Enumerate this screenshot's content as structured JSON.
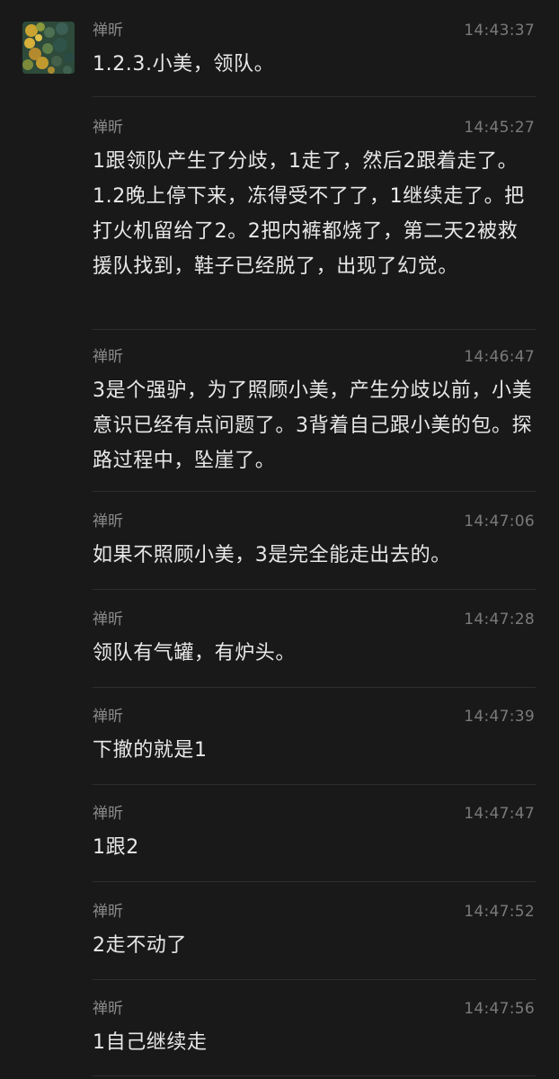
{
  "sender": "禅昕",
  "colors": {
    "background": "#191919",
    "text": "#e8e8e8",
    "meta": "#8b8b8b",
    "divider": "#2e2e2e"
  },
  "messages": [
    {
      "sender": "禅昕",
      "time": "14:43:37",
      "text": "1.2.3.小美，领队。"
    },
    {
      "sender": "禅昕",
      "time": "14:45:27",
      "text": "1跟领队产生了分歧，1走了，然后2跟着走了。1.2晚上停下来，冻得受不了了，1继续走了。把打火机留给了2。2把内裤都烧了，第二天2被救援队找到，鞋子已经脱了，出现了幻觉。"
    },
    {
      "sender": "禅昕",
      "time": "14:46:47",
      "text": "3是个强驴，为了照顾小美，产生分歧以前，小美意识已经有点问题了。3背着自己跟小美的包。探路过程中，坠崖了。"
    },
    {
      "sender": "禅昕",
      "time": "14:47:06",
      "text": "如果不照顾小美，3是完全能走出去的。"
    },
    {
      "sender": "禅昕",
      "time": "14:47:28",
      "text": "领队有气罐，有炉头。"
    },
    {
      "sender": "禅昕",
      "time": "14:47:39",
      "text": "下撤的就是1"
    },
    {
      "sender": "禅昕",
      "time": "14:47:47",
      "text": "1跟2"
    },
    {
      "sender": "禅昕",
      "time": "14:47:52",
      "text": "2走不动了"
    },
    {
      "sender": "禅昕",
      "time": "14:47:56",
      "text": "1自己继续走"
    }
  ]
}
